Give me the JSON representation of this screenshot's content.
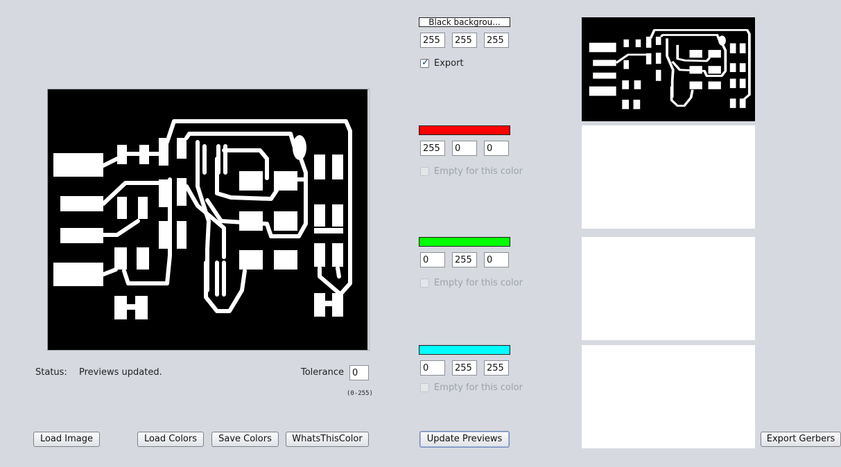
{
  "layers": [
    {
      "name": "Black backgrou...",
      "swatch_color": "#ffffff",
      "rgb": [
        "255",
        "255",
        "255"
      ],
      "checkbox_label": "Export",
      "checked": true,
      "enabled": true
    },
    {
      "name": "",
      "swatch_color": "#ff0000",
      "rgb": [
        "255",
        "0",
        "0"
      ],
      "checkbox_label": "Empty for this color",
      "checked": false,
      "enabled": false
    },
    {
      "name": "",
      "swatch_color": "#00ff00",
      "rgb": [
        "0",
        "255",
        "0"
      ],
      "checkbox_label": "Empty for this color",
      "checked": false,
      "enabled": false
    },
    {
      "name": "",
      "swatch_color": "#00ffff",
      "rgb": [
        "0",
        "255",
        "255"
      ],
      "checkbox_label": "Empty for this color",
      "checked": false,
      "enabled": false
    }
  ],
  "status": {
    "label": "Status:",
    "message": "Previews updated."
  },
  "tolerance": {
    "label": "Tolerance",
    "value": "0",
    "range_hint": "(0-255)"
  },
  "buttons": {
    "load_image": "Load Image",
    "load_colors": "Load Colors",
    "save_colors": "Save Colors",
    "whats_this_color": "WhatsThisColor",
    "update_previews": "Update Previews",
    "export_gerbers": "Export Gerbers"
  }
}
